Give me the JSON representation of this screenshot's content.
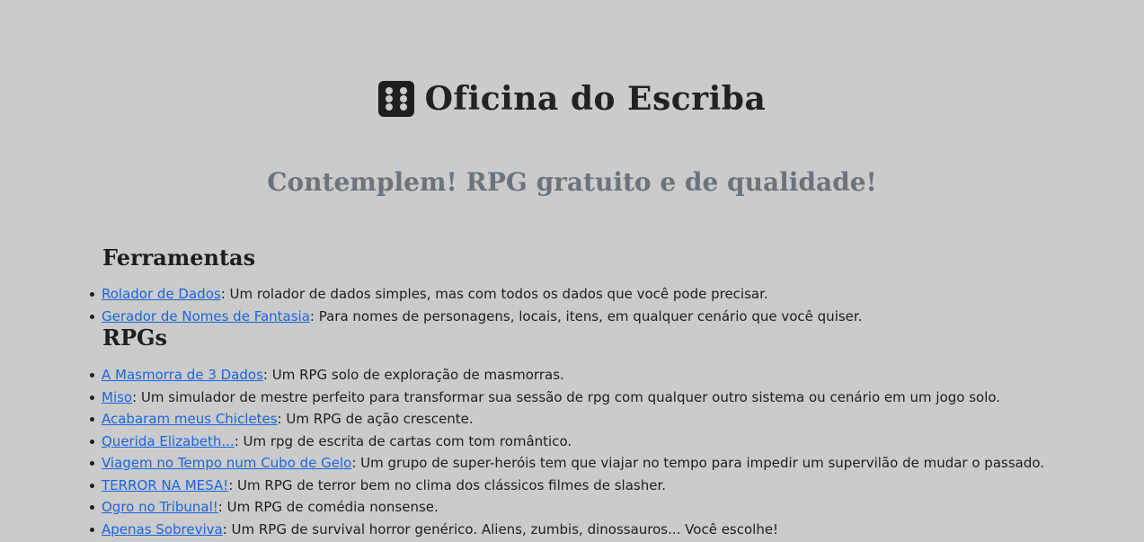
{
  "header": {
    "title": "Oficina do Escriba",
    "logo_icon": "dice-six-icon"
  },
  "tagline": "Contemplem! RPG gratuito e de qualidade!",
  "sections": [
    {
      "heading": "Ferramentas",
      "items": [
        {
          "link": "Rolador de Dados",
          "desc": ": Um rolador de dados simples, mas com todos os dados que você pode precisar."
        },
        {
          "link": "Gerador de Nomes de Fantasia",
          "desc": ": Para nomes de personagens, locais, itens, em qualquer cenário que você quiser."
        }
      ]
    },
    {
      "heading": "RPGs",
      "items": [
        {
          "link": "A Masmorra de 3 Dados",
          "desc": ": Um RPG solo de exploração de masmorras."
        },
        {
          "link": "Miso",
          "desc": ": Um simulador de mestre perfeito para transformar sua sessão de rpg com qualquer outro sistema ou cenário em um jogo solo."
        },
        {
          "link": "Acabaram meus Chicletes",
          "desc": ": Um RPG de ação crescente."
        },
        {
          "link": "Querida Elizabeth...",
          "desc": ": Um rpg de escrita de cartas com tom romântico."
        },
        {
          "link": "Viagem no Tempo num Cubo de Gelo",
          "desc": ": Um grupo de super-heróis tem que viajar no tempo para impedir um supervilão de mudar o passado."
        },
        {
          "link": "TERROR NA MESA!",
          "desc": ": Um RPG de terror bem no clima dos clássicos filmes de slasher."
        },
        {
          "link": "Ogro no Tribunal!",
          "desc": ": Um RPG de comédia nonsense."
        },
        {
          "link": "Apenas Sobreviva",
          "desc": ": Um RPG de survival horror genérico. Aliens, zumbis, dinossauros... Você escolhe!"
        }
      ]
    }
  ]
}
